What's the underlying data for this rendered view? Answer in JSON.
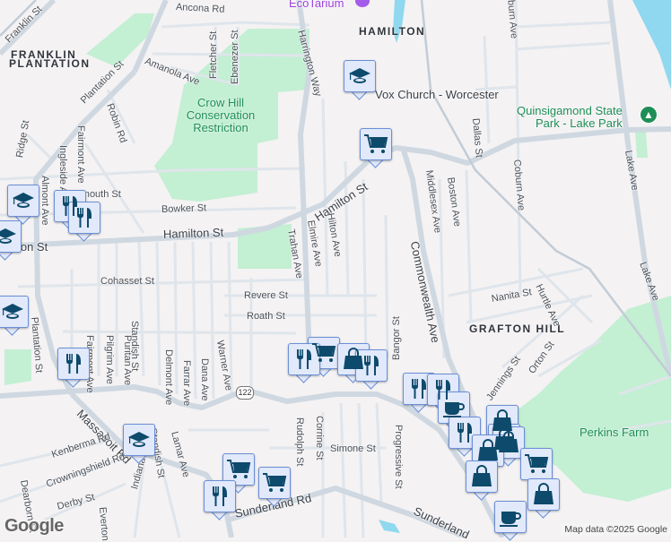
{
  "neighborhoods": {
    "franklin": "FRANKLIN",
    "plantation": "PLANTATION",
    "hamilton": "HAMILTON",
    "grafton_hill": "GRAFTON HILL"
  },
  "parks": {
    "crow_hill_1": "Crow Hill",
    "crow_hill_2": "Conservation",
    "crow_hill_3": "Restriction",
    "quinsig_1": "Quinsigamond State",
    "quinsig_2": "Park - Lake Park",
    "perkins": "Perkins Farm"
  },
  "places": {
    "ecotarium": "EcoTarium",
    "vox_church": "Vox Church - Worcester"
  },
  "streets": {
    "franklin_st": "Franklin St",
    "ancona_rd": "Ancona Rd",
    "plantation_st": "Plantation St",
    "plantation_st2": "Plantation St",
    "amanola_ave": "Amanola Ave",
    "fletcher_st": "Fletcher St",
    "ebenezer_st": "Ebenezer St",
    "harrington_way": "Harrington Way",
    "robin_rd": "Robin Rd",
    "ridge_st": "Ridge St",
    "fairmont_ave": "Fairmont Ave",
    "fairmont_ave2": "Fairmont Ave",
    "ingleside_ave": "Ingleside Ave",
    "almont_ave": "Almont Ave",
    "dartmouth_st": "Dartmouth St",
    "bowker_st": "Bowker St",
    "hamilton_st": "Hamilton St",
    "hamilton_st2": "Hamilton St",
    "hamilton_st3": "Hamilton St",
    "trahan_ave": "Trahan Ave",
    "elmire_ave": "Elmire Ave",
    "hilton_ave": "Hilton Ave",
    "middlesex_ave": "Middlesex Ave",
    "boston_ave": "Boston Ave",
    "dallas_st": "Dallas St",
    "coburn_ave": "Coburn Ave",
    "lake_ave": "Lake Ave",
    "lake_ave2": "Lake Ave",
    "commonwealth_ave": "Commonwealth Ave",
    "cohasset_st": "Cohasset St",
    "revere_st": "Revere St",
    "roath_st": "Roath St",
    "nanita_st": "Nanita St",
    "hurtle_ave": "Hurtle Ave",
    "orton_st": "Orton St",
    "jennings_st": "Jennings St",
    "standish_st": "Standish St",
    "standish_st2": "Standish St",
    "pilgrim_ave": "Pilgrim Ave",
    "puritan_ave": "Puritan Ave",
    "delmont_ave": "Delmont Ave",
    "farrar_ave": "Farrar Ave",
    "dana_ave": "Dana Ave",
    "warner_ave": "Warner Ave",
    "rudolph_st": "Rudolph St",
    "corrine_st": "Corrine St",
    "simone_st": "Simone St",
    "progressive_st": "Progressive St",
    "bangor_st": "Bangor St",
    "massasoit_rd": "Massasoit Rd",
    "kenberma_rd": "Kenberma Rd",
    "crowningshield_rd": "Crowningshield Rd",
    "derby_st": "Derby St",
    "dearborn_st": "Dearborn St",
    "everton": "Everton",
    "indiana_st": "Indiana St",
    "lamar_ave": "Lamar Ave",
    "sunderland_rd": "Sunderland Rd",
    "sunderland_rd2": "Sunderland"
  },
  "route_shield": "122",
  "footer": {
    "logo": "Google",
    "attribution": "Map data ©2025 Google"
  },
  "colors": {
    "marker_bg": "#e1e9fb",
    "marker_border": "#6b8fd6",
    "icon": "#0d4a6b",
    "park": "#c3efd3",
    "water": "#8fd8ef"
  }
}
